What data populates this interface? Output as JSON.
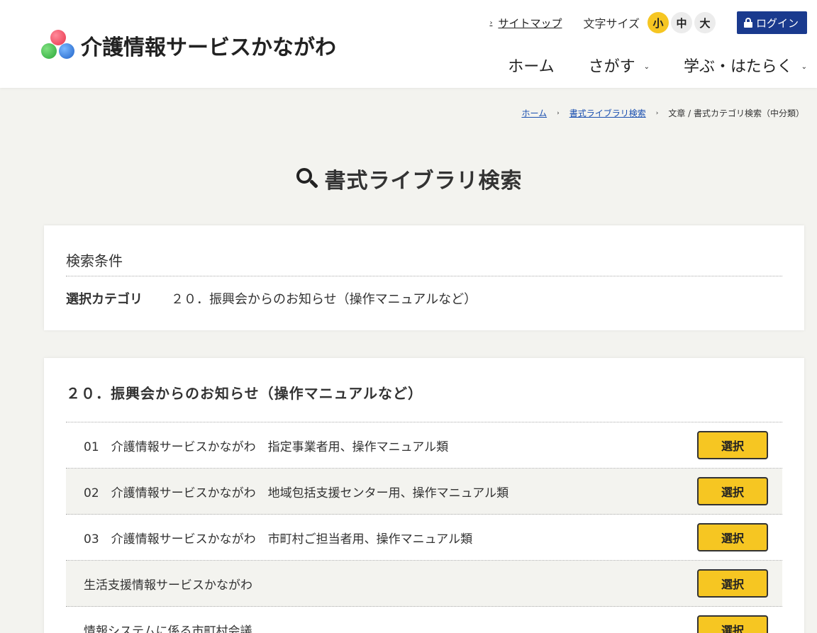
{
  "header": {
    "logo_text": "介護情報サービスかながわ",
    "sitemap_label": "サイトマップ",
    "fontsize_label": "文字サイズ",
    "fontsize_options": [
      "小",
      "中",
      "大"
    ],
    "fontsize_selected": "小",
    "login_label": "ログイン",
    "colors": {
      "accent_yellow": "#f6c622",
      "login_blue": "#1a3a8e"
    }
  },
  "nav": {
    "items": [
      {
        "label": "ホーム"
      },
      {
        "label": "さがす"
      },
      {
        "label": "学ぶ・はたらく"
      }
    ]
  },
  "breadcrumb": {
    "items": [
      "ホーム",
      "書式ライブラリ検索"
    ],
    "current": "文章 / 書式カテゴリ検索（中分類）"
  },
  "page": {
    "title": "書式ライブラリ検索"
  },
  "conditions": {
    "title": "検索条件",
    "label": "選択カテゴリ",
    "value": "２０．振興会からのお知らせ（操作マニュアルなど）"
  },
  "results": {
    "title": "２０．振興会からのお知らせ（操作マニュアルなど）",
    "select_label": "選択",
    "items": [
      {
        "text": "01　介護情報サービスかながわ　指定事業者用、操作マニュアル類"
      },
      {
        "text": "02　介護情報サービスかながわ　地域包括支援センター用、操作マニュアル類"
      },
      {
        "text": "03　介護情報サービスかながわ　市町村ご担当者用、操作マニュアル類"
      },
      {
        "text": "生活支援情報サービスかながわ"
      },
      {
        "text": "情報システムに係る市町村会議"
      }
    ]
  }
}
